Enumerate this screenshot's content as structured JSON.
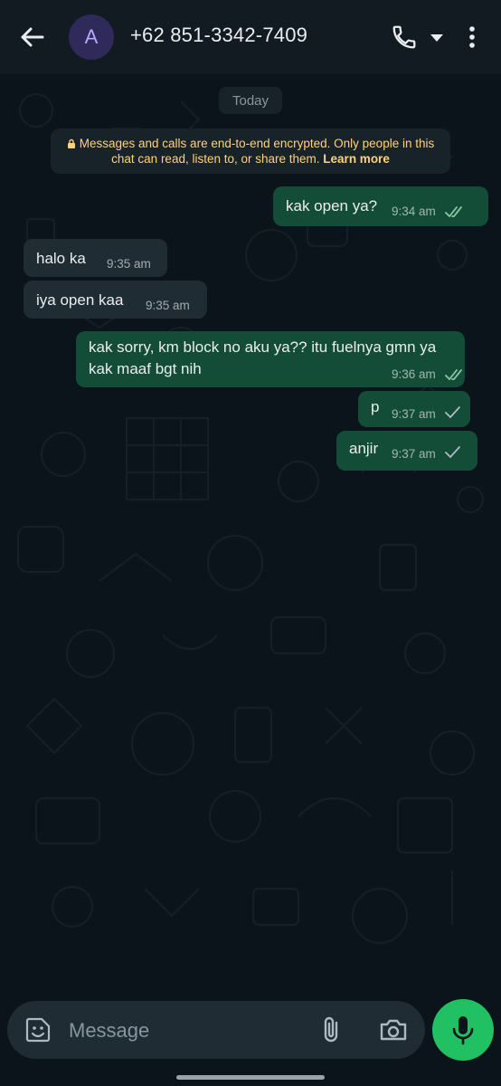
{
  "header": {
    "avatar_initial": "A",
    "contact": "+62 851-3342-7409"
  },
  "chat": {
    "date_chip": "Today",
    "encryption_notice": "Messages and calls are end-to-end encrypted. Only people in this chat can read, listen to, or share them.",
    "learn_more": "Learn more",
    "messages": [
      {
        "dir": "out",
        "text": "kak open ya?",
        "time": "9:34 am",
        "status": "read"
      },
      {
        "dir": "in",
        "text": "halo ka",
        "time": "9:35 am"
      },
      {
        "dir": "in",
        "text": "iya open kaa",
        "time": "9:35 am"
      },
      {
        "dir": "out",
        "text_line1": "kak sorry, km block no aku ya?? itu fuelnya gmn ya",
        "text_line2": "kak maaf bgt nih",
        "time": "9:36 am",
        "status": "read"
      },
      {
        "dir": "out",
        "text": "p",
        "time": "9:37 am",
        "status": "sent"
      },
      {
        "dir": "out",
        "text": "anjir",
        "time": "9:37 am",
        "status": "sent"
      }
    ]
  },
  "composer": {
    "placeholder": "Message"
  },
  "colors": {
    "outgoing_bubble": "#144d37",
    "incoming_bubble": "#202c33",
    "accent_green": "#21c063",
    "notice_text": "#ffd279",
    "read_tick": "#8cc7a8"
  }
}
